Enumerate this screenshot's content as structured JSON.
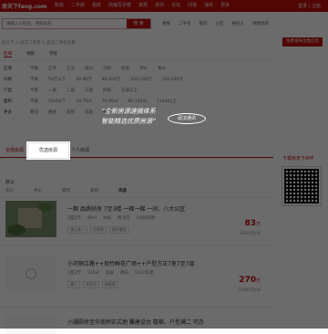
{
  "header": {
    "logo": "房天下fang.com",
    "nav": [
      "新房",
      "二手房",
      "租房",
      "商铺写字楼",
      "家居",
      "资讯",
      "论坛",
      "问答",
      "海外",
      "更多"
    ],
    "top_right": "登录 | 注册",
    "brand_color": "#c00d0d"
  },
  "search": {
    "placeholder": "请输入小区名、地铁站名...",
    "button": "搜 索",
    "hot_links": [
      "楼盘",
      "二手房",
      "租房",
      "小区",
      "经纪人",
      "地图找房"
    ]
  },
  "breadcrumb": "房天下 > 武汉二手房 > 武汉二手房出售",
  "publish_button": "免费发布出售信息",
  "filter": {
    "tabs": [
      "区域",
      "地铁",
      "学校"
    ],
    "rows": [
      {
        "label": "区域",
        "items": [
          "不限",
          "江岸",
          "江汉",
          "硚口",
          "汉阳",
          "武昌",
          "洪山",
          "青山"
        ]
      },
      {
        "label": "价格",
        "items": [
          "不限",
          "50万以下",
          "50-80万",
          "80-100万",
          "100-150万",
          "150-200万"
        ]
      },
      {
        "label": "户型",
        "items": [
          "不限",
          "一居",
          "二居",
          "三居",
          "四居",
          "五居以上"
        ]
      },
      {
        "label": "面积",
        "items": [
          "不限",
          "50㎡以下",
          "50-70㎡",
          "70-90㎡",
          "90-110㎡",
          "110㎡以上"
        ]
      },
      {
        "label": "更多",
        "items": [
          "朝向",
          "楼层",
          "装修",
          "房龄",
          "特色"
        ]
      }
    ]
  },
  "overlay": {
    "slogan_line1": "“全新房源速搞体系",
    "slogan_line2": "智能精选优质房源”",
    "stamp": "武汉通讯",
    "highlight_label": "优选房源"
  },
  "tabs": {
    "left": "全部房源",
    "selected": "优选房源",
    "right": "个人房源"
  },
  "app_panel": {
    "title": "下载房天下APP"
  },
  "sort_label": "默认",
  "columns": [
    "总价",
    "单价",
    "面积",
    "最新",
    "优选"
  ],
  "listings": [
    {
      "title": "一期 品质好房 7至3楼 一梯一梯 一间、八大公区",
      "meta": [
        "2室2厅",
        "89㎡",
        "中层",
        "南北向",
        "2008年建"
      ],
      "tags": [
        "满五唯一",
        "近地铁",
        "随时看房"
      ],
      "price": "83",
      "price_unit": "万",
      "unit_price": "9325元/㎡"
    },
    {
      "title": "小河铜江路++现竹鲜花广场++户型方正7室7至7层",
      "meta": [
        "3室2厅",
        "128㎡",
        "高层",
        "南向",
        "2012年建"
      ],
      "tags": [
        "满二",
        "学区房",
        "精装修"
      ],
      "price": "270",
      "price_unit": "万",
      "unit_price": "21093元/㎡"
    },
    {
      "title": "小潮厨房至华南师实式地 雕建设台 楼梯、户型满二 可办",
      "meta": [
        "2室1厅",
        "76㎡",
        "低层",
        "东南",
        "2005年建"
      ],
      "tags": [],
      "price": "",
      "price_unit": "",
      "unit_price": ""
    }
  ]
}
